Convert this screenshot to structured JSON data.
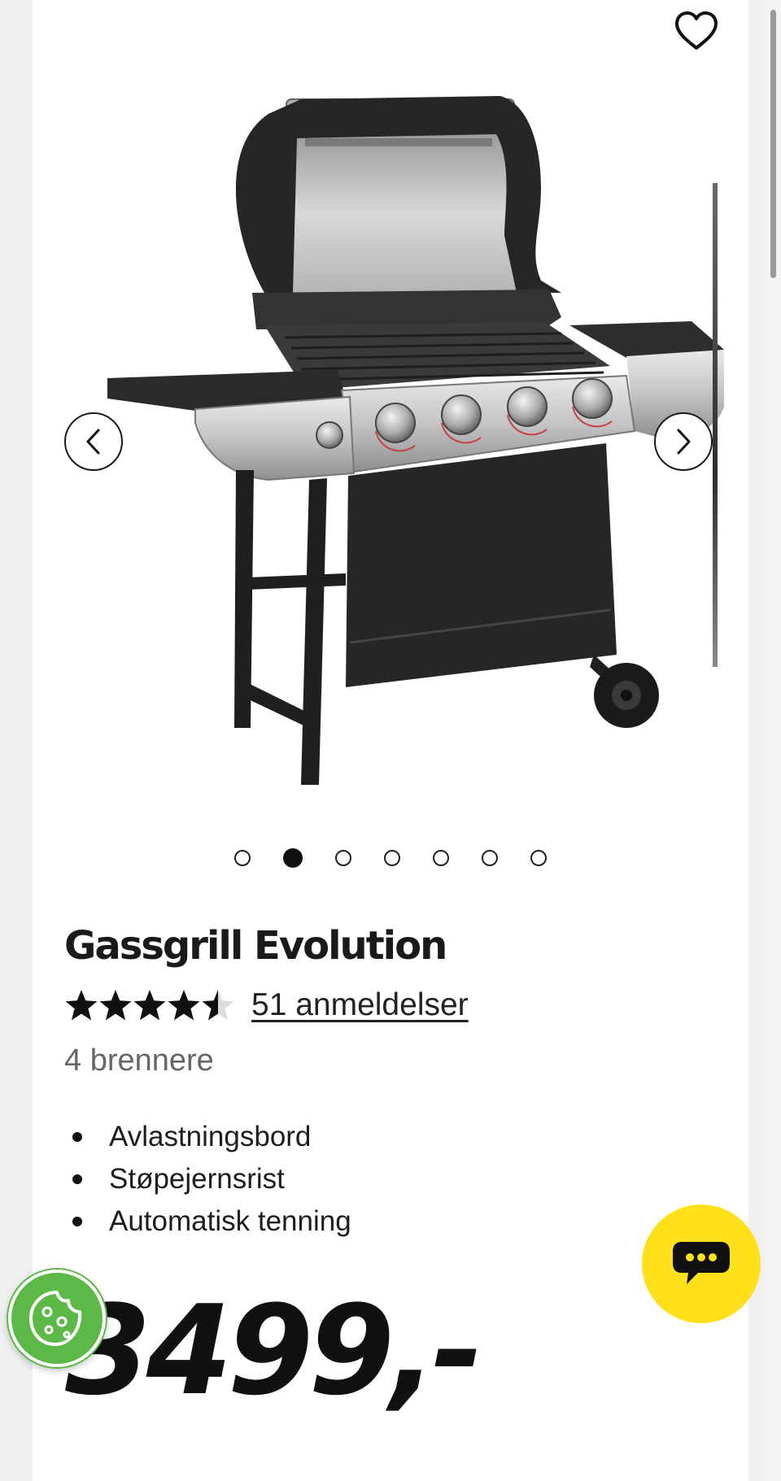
{
  "product": {
    "name": "Gassgrill Evolution",
    "rating": 4.5,
    "rating_max": 5,
    "reviews_label": "51 anmeldelser",
    "subtitle": "4 brennere",
    "features": [
      "Avlastningsbord",
      "Støpejernsrist",
      "Automatisk tenning"
    ],
    "price": "3499,-"
  },
  "gallery": {
    "image_count": 7,
    "active_index": 1,
    "prev_icon": "chevron-left-icon",
    "next_icon": "chevron-right-icon"
  },
  "icons": {
    "wishlist": "heart-icon",
    "chat": "chat-bubble-icon",
    "cookie": "cookie-icon"
  },
  "colors": {
    "chat_button": "#ffe01b",
    "cookie_button": "#5cb947",
    "text": "#111111",
    "subtitle": "#666666"
  }
}
